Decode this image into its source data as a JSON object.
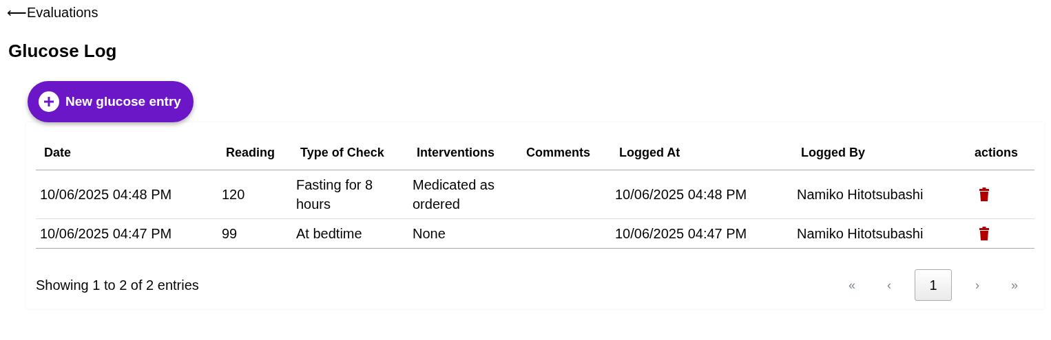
{
  "back_link": {
    "arrow": "⟵",
    "label": "Evaluations"
  },
  "title": "Glucose Log",
  "new_button": {
    "label": "New glucose entry"
  },
  "table": {
    "columns": [
      "Date",
      "Reading",
      "Type of Check",
      "Interventions",
      "Comments",
      "Logged At",
      "Logged By",
      "actions"
    ],
    "rows": [
      {
        "date": "10/06/2025 04:48 PM",
        "reading": "120",
        "type_of_check": "Fasting for 8 hours",
        "interventions": "Medicated as ordered",
        "comments": null,
        "logged_at": "10/06/2025 04:48 PM",
        "logged_by": "Namiko Hitotsubashi"
      },
      {
        "date": "10/06/2025 04:47 PM",
        "reading": "99",
        "type_of_check": "At bedtime",
        "interventions": "None",
        "comments": null,
        "logged_at": "10/06/2025 04:47 PM",
        "logged_by": "Namiko Hitotsubashi"
      }
    ]
  },
  "footer": {
    "summary": "Showing 1 to 2 of 2 entries",
    "pages": [
      {
        "label": "«",
        "kind": "nav",
        "selected": false
      },
      {
        "label": "‹",
        "kind": "nav",
        "selected": false
      },
      {
        "label": "1",
        "kind": "page",
        "selected": true
      },
      {
        "label": "›",
        "kind": "nav",
        "selected": false
      },
      {
        "label": "»",
        "kind": "nav",
        "selected": false
      }
    ]
  }
}
